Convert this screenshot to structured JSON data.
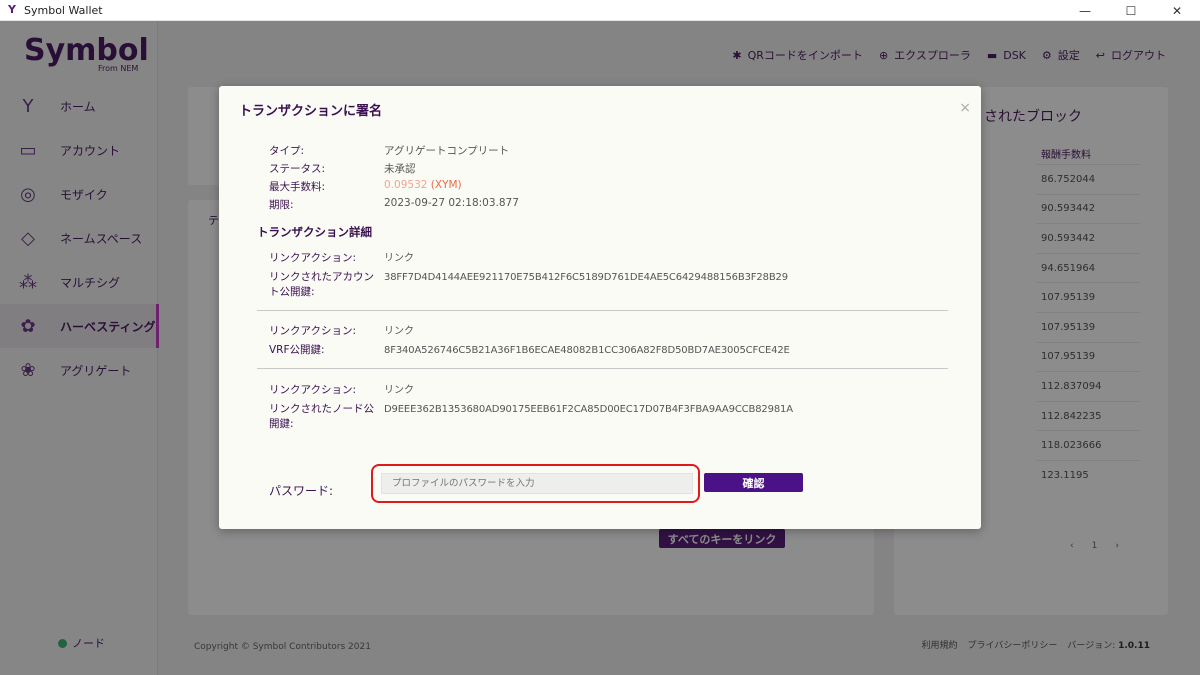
{
  "window": {
    "title": "Symbol Wallet",
    "minimize": "—",
    "maximize": "☐",
    "close": "✕"
  },
  "brand": {
    "logo": "Symbol",
    "sub": "From NEM"
  },
  "sidebar": {
    "items": [
      {
        "label": "ホーム",
        "icon": "home-icon",
        "glyph": "Y"
      },
      {
        "label": "アカウント",
        "icon": "wallet-icon",
        "glyph": "▭"
      },
      {
        "label": "モザイク",
        "icon": "coins-icon",
        "glyph": "◎"
      },
      {
        "label": "ネームスペース",
        "icon": "tag-icon",
        "glyph": "◇"
      },
      {
        "label": "マルチシグ",
        "icon": "multisig-icon",
        "glyph": "⁂"
      },
      {
        "label": "ハーベスティング",
        "icon": "harvest-icon",
        "glyph": "✿"
      },
      {
        "label": "アグリゲート",
        "icon": "aggregate-icon",
        "glyph": "❀"
      }
    ],
    "active_index": 5,
    "node_label": "ノード"
  },
  "header": {
    "items": [
      {
        "label": "QRコードをインポート",
        "icon": "qr-icon",
        "glyph": "✱"
      },
      {
        "label": "エクスプローラ",
        "icon": "globe-icon",
        "glyph": "⊕"
      },
      {
        "label": "DSK",
        "icon": "folder-icon",
        "glyph": "▬"
      },
      {
        "label": "設定",
        "icon": "gear-icon",
        "glyph": "⚙"
      },
      {
        "label": "ログアウト",
        "icon": "logout-icon",
        "glyph": "↩"
      }
    ]
  },
  "background": {
    "panel2_fragment": "テ",
    "blocks_title": "されたブロック",
    "reward_header": "報酬手数料",
    "rewards": [
      "86.752044",
      "90.593442",
      "90.593442",
      "94.651964",
      "107.95139",
      "107.95139",
      "107.95139",
      "112.837094",
      "112.842235",
      "118.023666",
      "123.1195"
    ],
    "pager": {
      "prev": "‹",
      "page": "1",
      "next": "›"
    },
    "link_all_label": "すべてのキーをリンク"
  },
  "footer": {
    "copyright": "Copyright © Symbol Contributors 2021",
    "terms": "利用規約",
    "privacy": "プライバシーポリシー",
    "version_label": "バージョン:",
    "version": "1.0.11"
  },
  "modal": {
    "title": "トランザクションに署名",
    "close": "×",
    "summary": [
      {
        "label": "タイプ:",
        "value": "アグリゲートコンプリート"
      },
      {
        "label": "ステータス:",
        "value": "未承認"
      },
      {
        "label": "最大手数料:",
        "value_zero": "0.",
        "value_rest": "09532",
        "value_unit": " (XYM)"
      },
      {
        "label": "期限:",
        "value": "2023-09-27 02:18:03.877"
      }
    ],
    "details_title": "トランザクション詳細",
    "details": [
      {
        "action_label": "リンクアクション:",
        "action_value": "リンク",
        "key_label": "リンクされたアカウント公開鍵:",
        "key_value": "38FF7D4D4144AEE921170E75B412F6C5189D761DE4AE5C6429488156B3F28B29"
      },
      {
        "action_label": "リンクアクション:",
        "action_value": "リンク",
        "key_label": "VRF公開鍵:",
        "key_value": "8F340A526746C5B21A36F1B6ECAE48082B1CC306A82F8D50BD7AE3005CFCE42E"
      },
      {
        "action_label": "リンクアクション:",
        "action_value": "リンク",
        "key_label": "リンクされたノード公開鍵:",
        "key_value": "D9EEE362B1353680AD90175EEB61F2CA85D00EC17D07B4F3FBA9AA9CCB82981A"
      }
    ],
    "password_label": "パスワード:",
    "password_placeholder": "プロファイルのパスワードを入力",
    "password_value": "",
    "confirm_label": "確認"
  }
}
